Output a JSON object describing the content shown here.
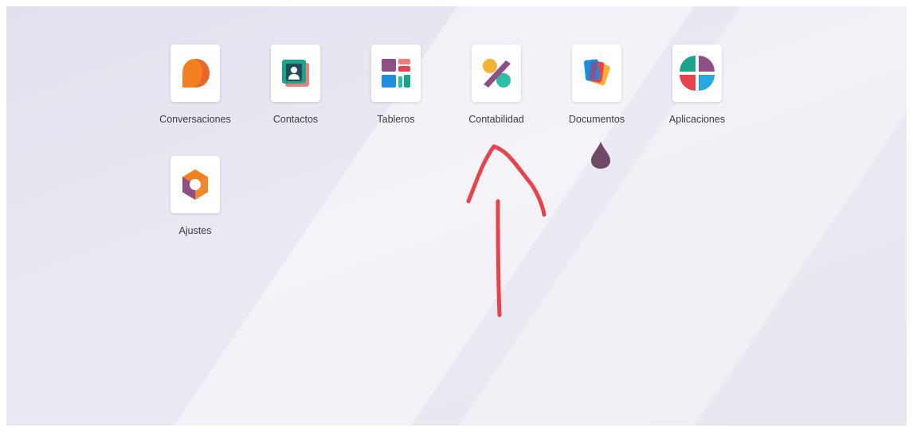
{
  "apps": [
    {
      "id": "conversaciones",
      "label": "Conversaciones",
      "icon": "conversaciones-icon"
    },
    {
      "id": "contactos",
      "label": "Contactos",
      "icon": "contactos-icon"
    },
    {
      "id": "tableros",
      "label": "Tableros",
      "icon": "tableros-icon"
    },
    {
      "id": "contabilidad",
      "label": "Contabilidad",
      "icon": "contabilidad-icon"
    },
    {
      "id": "documentos",
      "label": "Documentos",
      "icon": "documentos-icon"
    },
    {
      "id": "aplicaciones",
      "label": "Aplicaciones",
      "icon": "aplicaciones-icon"
    },
    {
      "id": "ajustes",
      "label": "Ajustes",
      "icon": "ajustes-icon"
    }
  ],
  "colors": {
    "annotation": "#e8434b",
    "cursor_drop": "#6e4a68",
    "orange": "#f2801e",
    "teal": "#2bbfa5",
    "purple": "#8d4f86"
  }
}
